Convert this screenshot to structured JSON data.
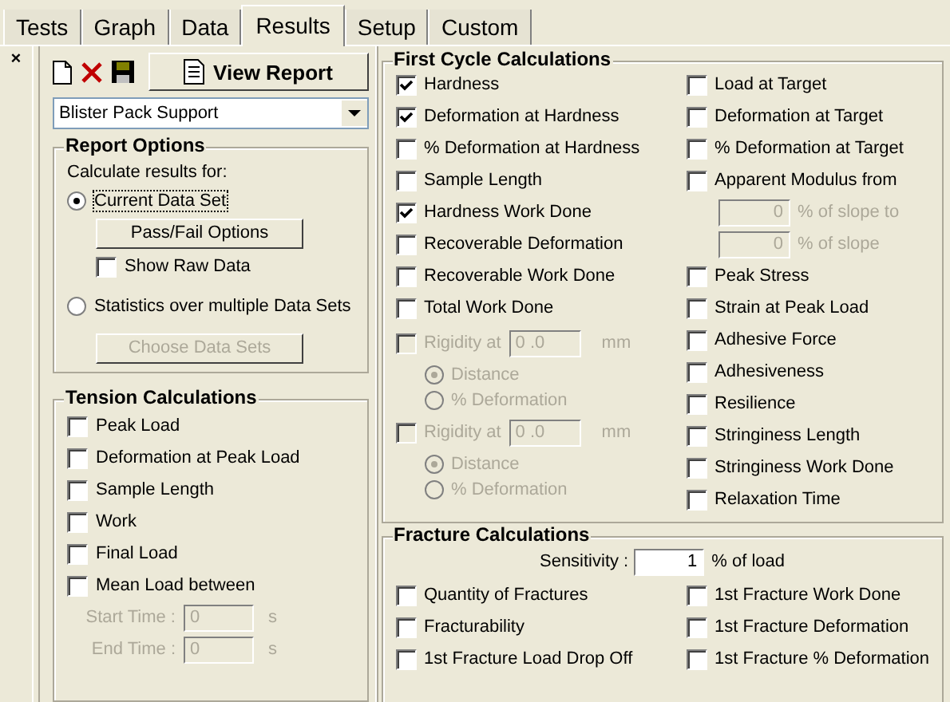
{
  "tabs": [
    {
      "label": "Tests",
      "selected": false
    },
    {
      "label": "Graph",
      "selected": false
    },
    {
      "label": "Data",
      "selected": false
    },
    {
      "label": "Results",
      "selected": true
    },
    {
      "label": "Setup",
      "selected": false
    },
    {
      "label": "Custom",
      "selected": false
    }
  ],
  "toolbar": {
    "close": "×",
    "view_report": "View Report"
  },
  "profile_select": {
    "value": "Blister Pack Support"
  },
  "report_options": {
    "title": "Report Options",
    "prompt": "Calculate results for:",
    "items": [
      {
        "kind": "radio",
        "label": "Current Data Set",
        "selected": true,
        "disabled": false
      },
      {
        "kind": "button",
        "label": "Pass/Fail Options",
        "disabled": false
      },
      {
        "kind": "checkbox",
        "label": "Show Raw Data",
        "checked": false,
        "disabled": false
      },
      {
        "kind": "radio",
        "label": "Statistics over multiple Data Sets",
        "selected": false,
        "disabled": false
      },
      {
        "kind": "button",
        "label": "Choose Data Sets",
        "disabled": true
      }
    ]
  },
  "tension": {
    "title": "Tension Calculations",
    "items": [
      {
        "label": "Peak Load",
        "checked": false
      },
      {
        "label": "Deformation at Peak Load",
        "checked": false
      },
      {
        "label": "Sample Length",
        "checked": false
      },
      {
        "label": "Work",
        "checked": false
      },
      {
        "label": "Final Load",
        "checked": false
      },
      {
        "label": "Mean Load between",
        "checked": false
      }
    ],
    "time_fields": [
      {
        "label": "Start Time :",
        "value": "0",
        "unit": "s",
        "disabled": true
      },
      {
        "label": "End Time :",
        "value": "0",
        "unit": "s",
        "disabled": true
      }
    ]
  },
  "first_cycle": {
    "title": "First Cycle Calculations",
    "left": [
      {
        "kind": "checkbox",
        "label": "Hardness",
        "checked": true,
        "disabled": false
      },
      {
        "kind": "checkbox",
        "label": "Deformation at Hardness",
        "checked": true,
        "disabled": false
      },
      {
        "kind": "checkbox",
        "label": "% Deformation at Hardness",
        "checked": false,
        "disabled": false
      },
      {
        "kind": "checkbox",
        "label": "Sample Length",
        "checked": false,
        "disabled": false
      },
      {
        "kind": "checkbox",
        "label": "Hardness Work Done",
        "checked": true,
        "disabled": false
      },
      {
        "kind": "checkbox",
        "label": "Recoverable Deformation",
        "checked": false,
        "disabled": false
      },
      {
        "kind": "checkbox",
        "label": "Recoverable Work Done",
        "checked": false,
        "disabled": false
      },
      {
        "kind": "checkbox",
        "label": "Total Work Done",
        "checked": false,
        "disabled": false
      },
      {
        "kind": "rigidity",
        "label": "Rigidity at",
        "value": "0 .0",
        "unit": "mm",
        "checked": false,
        "disabled": true
      },
      {
        "kind": "radio",
        "label": "Distance",
        "selected": true,
        "disabled": true
      },
      {
        "kind": "radio",
        "label": "% Deformation",
        "selected": false,
        "disabled": true
      },
      {
        "kind": "rigidity",
        "label": "Rigidity at",
        "value": "0 .0",
        "unit": "mm",
        "checked": false,
        "disabled": true
      },
      {
        "kind": "radio",
        "label": "Distance",
        "selected": true,
        "disabled": true
      },
      {
        "kind": "radio",
        "label": "% Deformation",
        "selected": false,
        "disabled": true
      }
    ],
    "right": [
      {
        "kind": "checkbox",
        "label": "Load at Target",
        "checked": false,
        "disabled": false
      },
      {
        "kind": "checkbox",
        "label": "Deformation at Target",
        "checked": false,
        "disabled": false
      },
      {
        "kind": "checkbox",
        "label": "% Deformation at Target",
        "checked": false,
        "disabled": false
      },
      {
        "kind": "checkbox",
        "label": "Apparent Modulus from",
        "checked": false,
        "disabled": false
      },
      {
        "kind": "field",
        "value": "0",
        "unit": "% of slope to",
        "disabled": true
      },
      {
        "kind": "field",
        "value": "0",
        "unit": "% of slope",
        "disabled": true
      },
      {
        "kind": "checkbox",
        "label": "Peak Stress",
        "checked": false,
        "disabled": false
      },
      {
        "kind": "checkbox",
        "label": "Strain at Peak Load",
        "checked": false,
        "disabled": false
      },
      {
        "kind": "checkbox",
        "label": "Adhesive Force",
        "checked": false,
        "disabled": false
      },
      {
        "kind": "checkbox",
        "label": "Adhesiveness",
        "checked": false,
        "disabled": false
      },
      {
        "kind": "checkbox",
        "label": "Resilience",
        "checked": false,
        "disabled": false
      },
      {
        "kind": "checkbox",
        "label": "Stringiness Length",
        "checked": false,
        "disabled": false
      },
      {
        "kind": "checkbox",
        "label": "Stringiness Work Done",
        "checked": false,
        "disabled": false
      },
      {
        "kind": "checkbox",
        "label": "Relaxation Time",
        "checked": false,
        "disabled": false
      }
    ]
  },
  "fracture": {
    "title": "Fracture Calculations",
    "sensitivity": {
      "label": "Sensitivity :",
      "value": "1",
      "unit": "% of load"
    },
    "left": [
      {
        "label": "Quantity of Fractures",
        "checked": false
      },
      {
        "label": "Fracturability",
        "checked": false
      },
      {
        "label": "1st Fracture Load Drop Off",
        "checked": false
      }
    ],
    "right": [
      {
        "label": "1st Fracture Work Done",
        "checked": false
      },
      {
        "label": "1st Fracture Deformation",
        "checked": false
      },
      {
        "label": "1st Fracture % Deformation",
        "checked": false
      }
    ]
  }
}
